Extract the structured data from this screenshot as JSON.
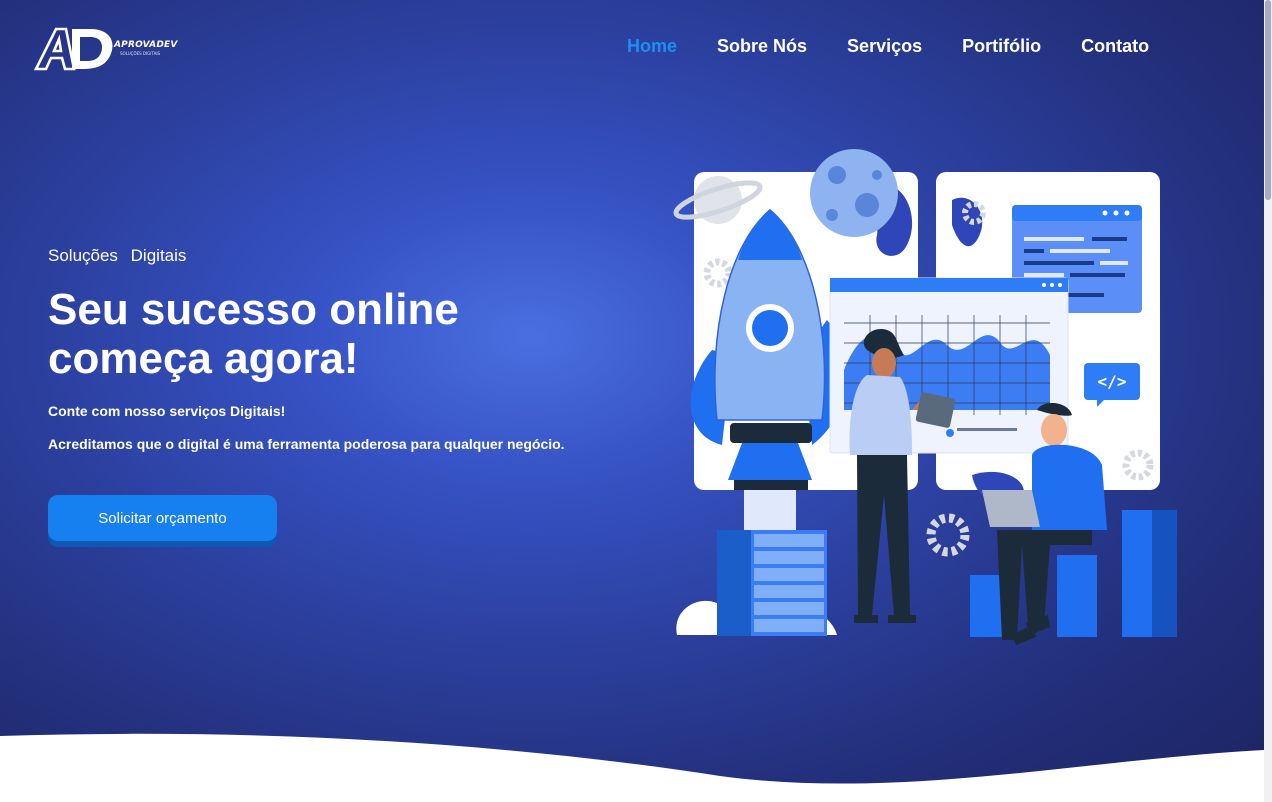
{
  "header": {
    "logo_letters": "AD",
    "logo_brand": "APROVADEV",
    "logo_tagline": "SOLUÇÕES DIGITAIS",
    "nav": [
      {
        "label": "Home",
        "active": true
      },
      {
        "label": "Sobre Nós",
        "active": false
      },
      {
        "label": "Serviços",
        "active": false
      },
      {
        "label": "Portifólio",
        "active": false
      },
      {
        "label": "Contato",
        "active": false
      }
    ]
  },
  "hero": {
    "eyebrow": "Soluções Digitais",
    "headline": "Seu sucesso online começa agora!",
    "paragraph1": "Conte com nosso serviços Digitais!",
    "paragraph2": "Acreditamos que o digital é uma ferramenta poderosa para qualquer negócio.",
    "cta_label": "Solicitar orçamento",
    "code_badge": "</>"
  },
  "colors": {
    "accent": "#1f8ef1",
    "button": "#1680f0",
    "hero_bg": "#2b3f9d"
  },
  "icons": [
    "rocket-icon",
    "planet-icon",
    "moon-icon",
    "gear-icon",
    "code-icon",
    "server-icon",
    "chart-icon"
  ]
}
